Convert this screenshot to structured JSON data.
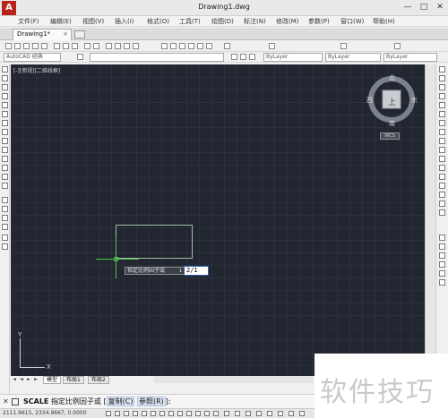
{
  "window": {
    "title": "Drawing1.dwg",
    "logo_letter": "A",
    "minimize": "—",
    "maximize": "□",
    "close": "✕"
  },
  "menu": {
    "items": [
      "文件(F)",
      "编辑(E)",
      "视图(V)",
      "插入(I)",
      "格式(O)",
      "工具(T)",
      "绘图(D)",
      "标注(N)",
      "修改(M)",
      "参数(P)",
      "窗口(W)",
      "帮助(H)"
    ]
  },
  "tabs": {
    "document": "Drawing1*",
    "close": "×"
  },
  "toolbar": {
    "workspace": "AutoCAD 经典",
    "layer_combo": "ByLayer",
    "linetype_combo": "ByLayer",
    "lineweight_combo": "ByLayer"
  },
  "canvas": {
    "viewport_label": "[-][俯视][二维线框]",
    "dynamic_prompt": "指定比例因子或",
    "dynamic_arrow": "↓",
    "dynamic_input_value": "2/1",
    "ucs_x": "X",
    "ucs_y": "Y"
  },
  "viewcube": {
    "north": "北",
    "south": "南",
    "east": "东",
    "west": "西",
    "top_face": "上",
    "wcs": "WCS"
  },
  "layout_tabs": {
    "nav": [
      "◄",
      "◄",
      "►",
      "►"
    ],
    "tabs": [
      "模型",
      "布局1",
      "布局2"
    ]
  },
  "command": {
    "name": "SCALE",
    "prompt": "指定比例因子或",
    "option_copy": "复制(C)",
    "option_reference": "参照(R)",
    "open_bracket": "[",
    "close_bracket": "]:"
  },
  "status": {
    "coords": "2111.9615, 2334.9667, 0.0000"
  },
  "watermark": {
    "text": "软件技巧"
  },
  "colors": {
    "canvas_bg": "#222630",
    "crosshair": "#4fc24f",
    "input_border": "#2f5fb0"
  }
}
